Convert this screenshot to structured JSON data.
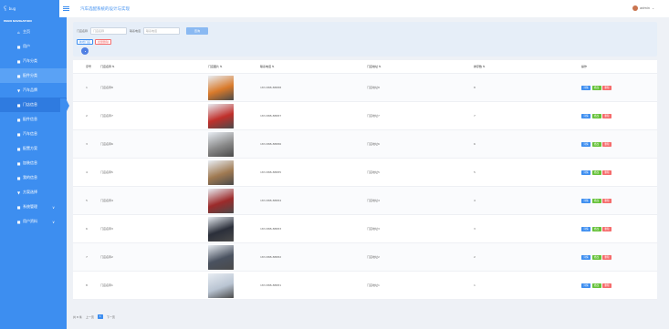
{
  "logo": {
    "mark": "ʕ",
    "text": "bug"
  },
  "app": {
    "title": "汽车选配系统的设计与实现"
  },
  "user": {
    "name": "admin",
    "caret": "⌄"
  },
  "sidebar": {
    "caption": "MAIN NAVIGATION",
    "items": [
      {
        "icon": "⌂",
        "label": "主页",
        "state": ""
      },
      {
        "icon": "■",
        "label": "用户",
        "state": ""
      },
      {
        "icon": "■",
        "label": "汽车分类",
        "state": ""
      },
      {
        "icon": "■",
        "label": "配件分类",
        "state": "hl"
      },
      {
        "icon": "▼",
        "label": "汽车品牌",
        "state": ""
      },
      {
        "icon": "■",
        "label": "门店信息",
        "state": "active"
      },
      {
        "icon": "■",
        "label": "配件信息",
        "state": ""
      },
      {
        "icon": "■",
        "label": "汽车信息",
        "state": ""
      },
      {
        "icon": "■",
        "label": "配置方案",
        "state": ""
      },
      {
        "icon": "■",
        "label": "加装信息",
        "state": ""
      },
      {
        "icon": "■",
        "label": "我的信息",
        "state": ""
      },
      {
        "icon": "▼",
        "label": "方案选择",
        "state": ""
      },
      {
        "icon": "■",
        "label": "系统管理",
        "state": "",
        "chev": "∨"
      },
      {
        "icon": "■",
        "label": "用户资料",
        "state": "",
        "chev": "∨"
      }
    ]
  },
  "search": {
    "name_label": "门店名称",
    "name_placeholder": "门店名称",
    "phone_label": "联系电话",
    "phone_placeholder": "联系电话",
    "button": "查询",
    "add_button": "新增门店",
    "delete_button": "批量删除"
  },
  "table": {
    "headers": [
      "序号",
      "门店名称 ⇅",
      "门店图片 ⇅",
      "联系电话 ⇅",
      "门店地址 ⇅",
      "排序数 ⇅",
      "操作"
    ],
    "rows": [
      {
        "idx": "1",
        "name": "门店名称8",
        "phone": "183-888-88888",
        "addr": "门店地址8",
        "rank": "8",
        "color": "#d97a2b"
      },
      {
        "idx": "2",
        "name": "门店名称7",
        "phone": "183-888-88887",
        "addr": "门店地址7",
        "rank": "7",
        "color": "#c0302b"
      },
      {
        "idx": "3",
        "name": "门店名称6",
        "phone": "183-888-88886",
        "addr": "门店地址6",
        "rank": "6",
        "color": "#8a8a8a"
      },
      {
        "idx": "4",
        "name": "门店名称5",
        "phone": "183-888-88885",
        "addr": "门店地址5",
        "rank": "5",
        "color": "#a07a52"
      },
      {
        "idx": "5",
        "name": "门店名称4",
        "phone": "183-888-88884",
        "addr": "门店地址4",
        "rank": "4",
        "color": "#9c2a2a"
      },
      {
        "idx": "6",
        "name": "门店名称3",
        "phone": "183-888-88883",
        "addr": "门店地址3",
        "rank": "3",
        "color": "#2b2f3a"
      },
      {
        "idx": "7",
        "name": "门店名称2",
        "phone": "183-888-88882",
        "addr": "门店地址2",
        "rank": "2",
        "color": "#4a5260"
      },
      {
        "idx": "8",
        "name": "门店名称1",
        "phone": "183-888-88881",
        "addr": "门店地址1",
        "rank": "1",
        "color": "#b9c4d2"
      }
    ],
    "ops": {
      "detail": "详情",
      "edit": "修改",
      "delete": "删除"
    }
  },
  "pager": {
    "total": "共 8 条",
    "prev": "上一页",
    "current": "1",
    "next": "下一页"
  }
}
